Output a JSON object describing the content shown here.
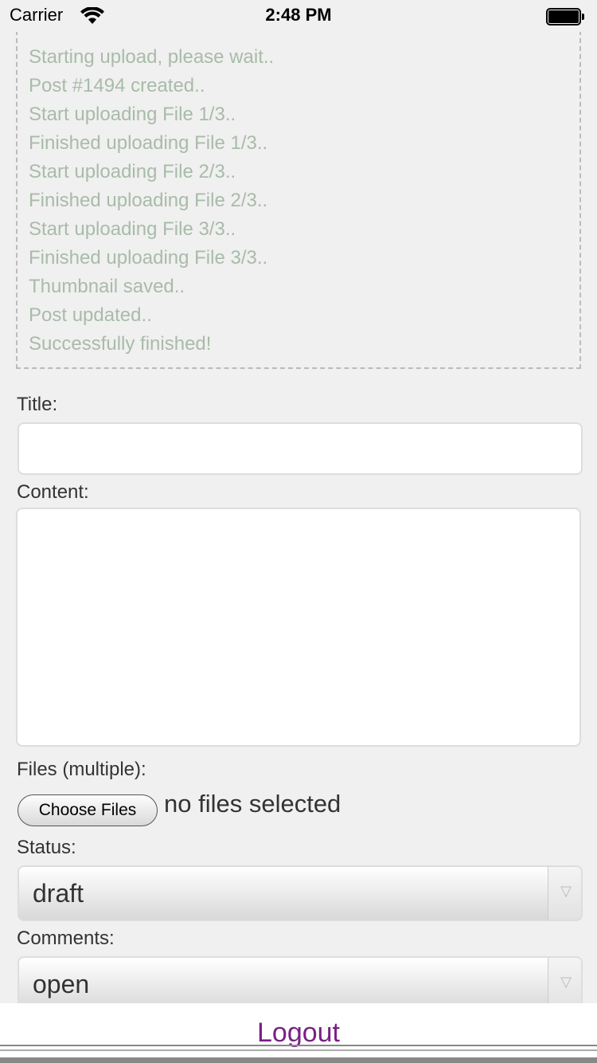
{
  "status_bar": {
    "carrier": "Carrier",
    "time": "2:48 PM"
  },
  "log": {
    "lines": [
      "Starting upload, please wait..",
      "Post #1494 created..",
      "Start uploading File 1/3..",
      "Finished uploading File 1/3..",
      "Start uploading File 2/3..",
      "Finished uploading File 2/3..",
      "Start uploading File 3/3..",
      "Finished uploading File 3/3..",
      "Thumbnail saved..",
      "Post updated..",
      "Successfully finished!"
    ]
  },
  "form": {
    "title_label": "Title:",
    "title_value": "",
    "content_label": "Content:",
    "content_value": "",
    "files_label": "Files (multiple):",
    "choose_files_label": "Choose Files",
    "no_files_text": "no files selected",
    "status_label": "Status:",
    "status_value": "draft",
    "comments_label": "Comments:",
    "comments_value": "open"
  },
  "footer": {
    "logout_label": "Logout"
  },
  "colors": {
    "log_text": "#a9bba9",
    "link": "#7a1f86",
    "background": "#f0f0f0"
  },
  "icons": [
    "wifi-icon",
    "battery-icon",
    "chevron-down-icon"
  ]
}
